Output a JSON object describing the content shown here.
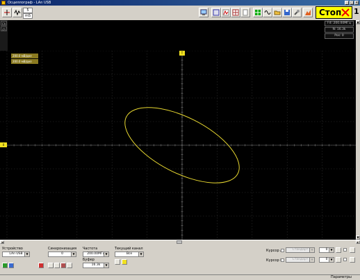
{
  "window": {
    "title": "Осциллограф - LAn USB"
  },
  "toolbar": {
    "spinner_top": "5",
    "spinner_bottom": "mS",
    "stop_label": "Стоп",
    "stop_number": "1"
  },
  "info_panel": {
    "frequency": "Fd: 200.00МГц",
    "samples": "N: 16.3k",
    "position": "Pos: 0"
  },
  "side_strip": {
    "item1": "Ch",
    "item2": "ch"
  },
  "channels": [
    {
      "label": "200.0 мВ/дел",
      "color": "#c8a020"
    },
    {
      "label": "200.0 мВ/дел",
      "color": "#c8a020"
    }
  ],
  "markers": {
    "trigger": "T",
    "zero": "0"
  },
  "trace": {
    "color": "#e8d830"
  },
  "bottom": {
    "device": {
      "label": "Устройство",
      "value": "LAn USB"
    },
    "sync": {
      "label": "Синхронизация",
      "value": "0"
    },
    "frequency": {
      "label": "Частота",
      "value": "200.00МГц"
    },
    "buffer": {
      "label": "Буфер",
      "value": "16.3k"
    },
    "current_channel": {
      "label": "Текущий канал",
      "value": "Все"
    },
    "cursor_a": {
      "label": "Курсор A",
      "mode": "Стандарт",
      "value": "0"
    },
    "cursor_b": {
      "label": "Курсор B",
      "mode": "Стандарт",
      "value": "0"
    }
  },
  "statusbar": {
    "params": "Параметры"
  }
}
